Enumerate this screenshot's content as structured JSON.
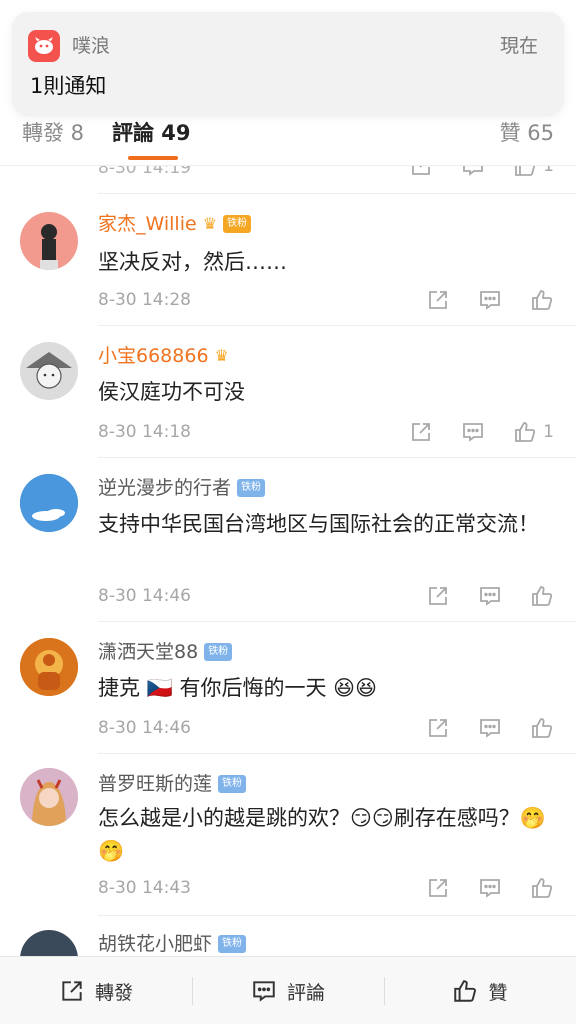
{
  "notification": {
    "app_name": "噗浪",
    "time": "現在",
    "body": "1則通知"
  },
  "tabs": {
    "repost": "轉發 8",
    "comments": "評論 49",
    "likes": "贊 65"
  },
  "partial_row": {
    "time": "8-30 14:19",
    "like_count": "1"
  },
  "comments": [
    {
      "user": "家杰_Willie",
      "badge": "铁粉",
      "text": "坚决反对，然后……",
      "time": "8-30 14:28",
      "likes": ""
    },
    {
      "user": "小宝668866",
      "badge": "",
      "text": "侯汉庭功不可没",
      "time": "8-30 14:18",
      "likes": "1"
    },
    {
      "user": "逆光漫步的行者",
      "badge": "铁粉",
      "text": "支持中华民国台湾地区与国际社会的正常交流！",
      "time": "8-30 14:46",
      "likes": ""
    },
    {
      "user": "潇洒天堂88",
      "badge": "铁粉",
      "text": "捷克 🇨🇿 有你后悔的一天 😆😆",
      "time": "8-30 14:46",
      "likes": ""
    },
    {
      "user": "普罗旺斯的莲",
      "badge": "铁粉",
      "text": "怎么越是小的越是跳的欢？😏😏刷存在感吗？🤭🤭",
      "time": "8-30 14:43",
      "likes": ""
    },
    {
      "user": "胡铁花小肥虾",
      "badge": "铁粉",
      "text": "",
      "time": "",
      "likes": ""
    }
  ],
  "bottom_bar": {
    "repost": "轉發",
    "comment": "評論",
    "like": "贊"
  },
  "colors": {
    "accent": "#f26c1d",
    "vip_name": "#f0731f",
    "badge": "#7fb3ea"
  }
}
